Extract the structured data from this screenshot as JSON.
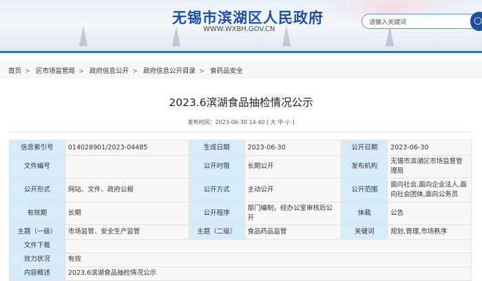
{
  "header": {
    "site_title": "无锡市滨湖区人民政府",
    "site_url": "WWW.WXBH.GOV.CN",
    "search_placeholder": "请输入关键词"
  },
  "breadcrumb": [
    "首页",
    "区市场监管局",
    "政府信息公开",
    "政府信息公开目录",
    "食药品安全"
  ],
  "article": {
    "title": "2023.6滨湖食品抽检情况公示",
    "publish_label": "发布时间：",
    "publish_time": "2023-06-30 14:40",
    "font_open": "[",
    "font_large": "大",
    "font_medium": "中",
    "font_small": "小",
    "font_close": "]"
  },
  "meta": {
    "rows": [
      [
        [
          "信息索引号",
          "014028901/2023-04485"
        ],
        [
          "生成日期",
          "2023-06-30"
        ],
        [
          "公开日期",
          "2023-06-30"
        ]
      ],
      [
        [
          "文件编号",
          ""
        ],
        [
          "公开时限",
          "长期公开"
        ],
        [
          "发布机构",
          "无锡市滨湖区市场监督管理局"
        ]
      ],
      [
        [
          "公开形式",
          "网站、文件、政府公报"
        ],
        [
          "公开方式",
          "主动公开"
        ],
        [
          "公开范围",
          "面向社会,面向企业法人,面向社会团体,面向公务员"
        ]
      ],
      [
        [
          "有效期",
          "长期"
        ],
        [
          "公开程序",
          "部门编制，经办公室审核后公开"
        ],
        [
          "体裁",
          "公告"
        ]
      ],
      [
        [
          "主题（一级）",
          "市场监管、安全生产监管"
        ],
        [
          "主题（二级）",
          "食品药品监管"
        ],
        [
          "关键词",
          "规划,管理,市场秩序"
        ]
      ]
    ],
    "wide": [
      [
        "文件下载",
        ""
      ],
      [
        "效力状况",
        "有效"
      ],
      [
        "内容概述",
        "2023.6滨湖食品抽检情况公示"
      ]
    ]
  }
}
